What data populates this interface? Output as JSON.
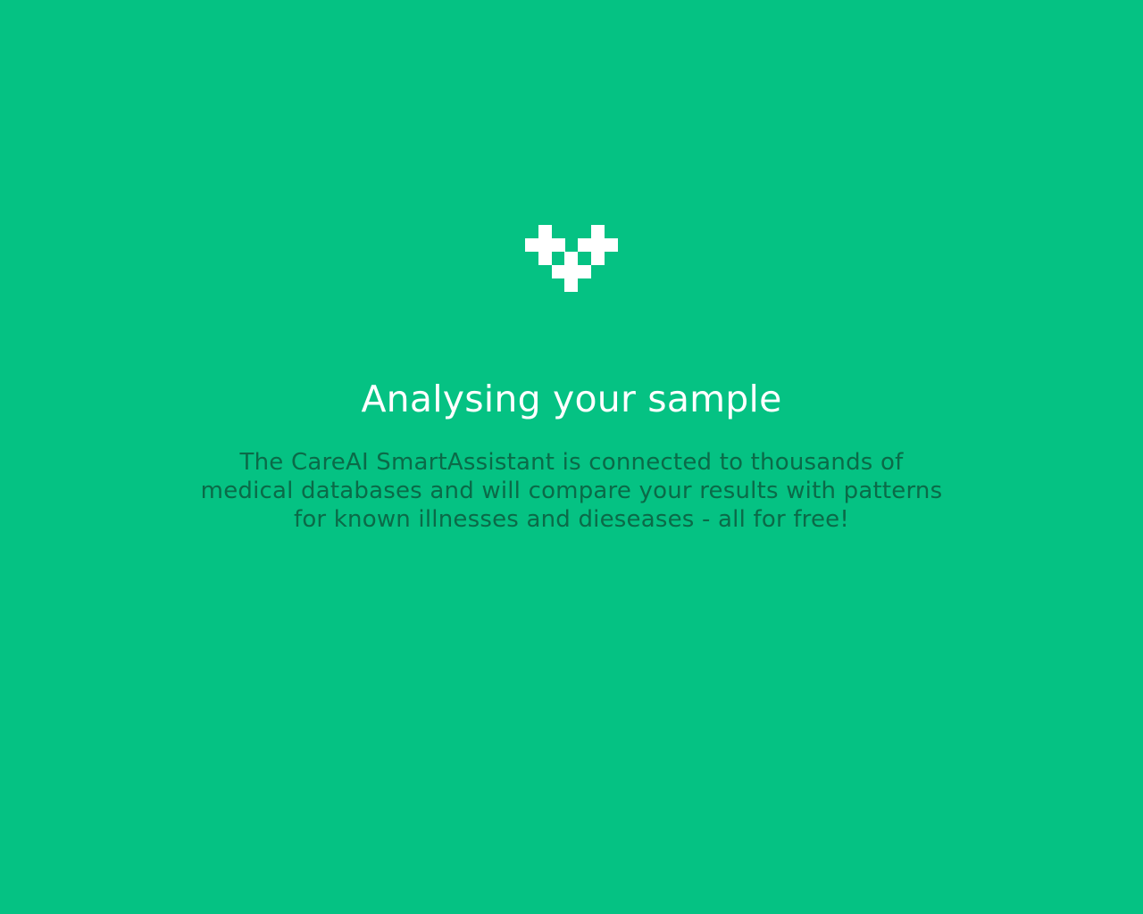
{
  "colors": {
    "background": "#05c283",
    "title": "#ffffff",
    "description": "#0b6a48",
    "logo": "#ffffff"
  },
  "logo": {
    "icon": "pixel-heart-icon"
  },
  "content": {
    "title": "Analysing your sample",
    "description": "The CareAI SmartAssistant is connected to thousands of medical databases and will compare your results with patterns for known illnesses and dieseases - all for free!"
  }
}
